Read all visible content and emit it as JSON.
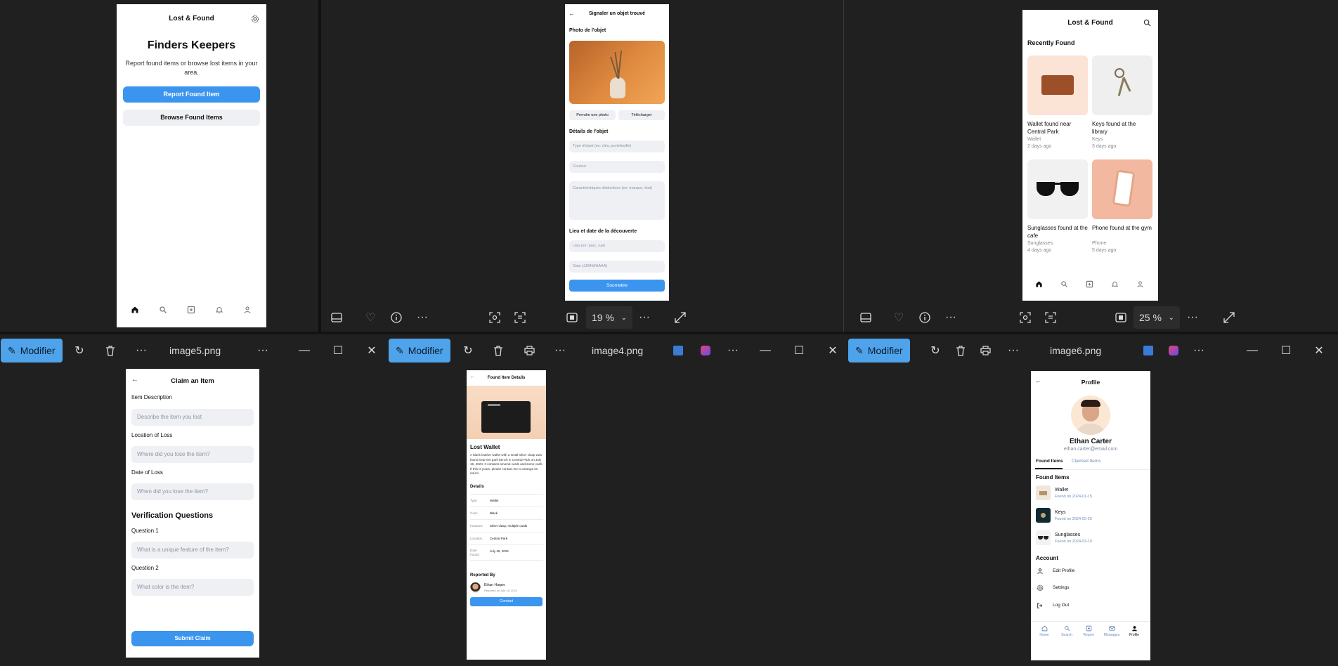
{
  "p1": {
    "header": "Lost & Found",
    "title": "Finders Keepers",
    "subtitle": "Report found items or browse lost items in your area.",
    "report_btn": "Report Found Item",
    "browse_btn": "Browse Found Items"
  },
  "p2": {
    "header": "Signaler un objet trouvé",
    "photo_section": "Photo de l'objet",
    "take_photo": "Prendre une photo",
    "upload": "Télécharger",
    "details_section": "Détails de l'objet",
    "type_ph": "Type d'objet (ex: clés, portefeuille)",
    "color_ph": "Couleur",
    "features_ph": "Caractéristiques distinctives (ex: marque, état)",
    "location_section": "Lieu et date de la découverte",
    "location_ph": "Lieu (ex: parc, rue)",
    "date_ph": "Date (JJ/MM/AAAA)",
    "submit": "Soumettre",
    "zoom": "19 %"
  },
  "p3": {
    "header": "Lost & Found",
    "section": "Recently Found",
    "items": [
      {
        "title": "Wallet found near Central Park",
        "cat": "Wallet",
        "time": "2 days ago"
      },
      {
        "title": "Keys found at the library",
        "cat": "Keys",
        "time": "3 days ago"
      },
      {
        "title": "Sunglasses found at the cafe",
        "cat": "Sunglasses",
        "time": "4 days ago"
      },
      {
        "title": "Phone found at the gym",
        "cat": "Phone",
        "time": "5 days ago"
      }
    ],
    "zoom": "25 %"
  },
  "p4": {
    "header": "Claim an Item",
    "desc_label": "Item Description",
    "desc_ph": "Describe the item you lost",
    "loc_label": "Location of Loss",
    "loc_ph": "Where did you lose the item?",
    "date_label": "Date of Loss",
    "date_ph": "When did you lose the item?",
    "verif_title": "Verification Questions",
    "q1_label": "Question 1",
    "q1_ph": "What is a unique feature of the item?",
    "q2_label": "Question 2",
    "q2_ph": "What color is the item?",
    "submit": "Submit Claim"
  },
  "p5": {
    "header": "Found Item Details",
    "title": "Lost Wallet",
    "description": "A black leather wallet with a small silver clasp was found near the park bench in Central Park on July 15, 2024. It contains several cards and some cash. If this is yours, please contact me to arrange its return.",
    "details_title": "Details",
    "rows": [
      {
        "k": "Type",
        "v": "Wallet"
      },
      {
        "k": "Color",
        "v": "Black"
      },
      {
        "k": "Features",
        "v": "Silver clasp, multiple cards"
      },
      {
        "k": "Location",
        "v": "Central Park"
      },
      {
        "k": "Date Found",
        "v": "July 15, 2024"
      }
    ],
    "reported_title": "Reported By",
    "reporter": "Ethan Harper",
    "reported_on": "Reported on July 15, 2024",
    "contact": "Contact"
  },
  "p6": {
    "header": "Profile",
    "name": "Ethan Carter",
    "email": "ethan.carter@email.com",
    "tab1": "Found Items",
    "tab2": "Claimed Items",
    "found_title": "Found Items",
    "items": [
      {
        "name": "Wallet",
        "date": "Found on 2024-01-15"
      },
      {
        "name": "Keys",
        "date": "Found on 2024-02-20"
      },
      {
        "name": "Sunglasses",
        "date": "Found on 2024-03-10"
      }
    ],
    "account_title": "Account",
    "edit": "Edit Profile",
    "settings": "Settings",
    "logout": "Log Out",
    "nav": [
      "Home",
      "Search",
      "Report",
      "Messages",
      "Profile"
    ]
  },
  "windows": {
    "modifier": "Modifier",
    "file5": "image5.png",
    "file4": "image4.png",
    "file6": "image6.png"
  },
  "colors": {
    "accent": "#3b95ef",
    "toolbar": "#202020"
  }
}
